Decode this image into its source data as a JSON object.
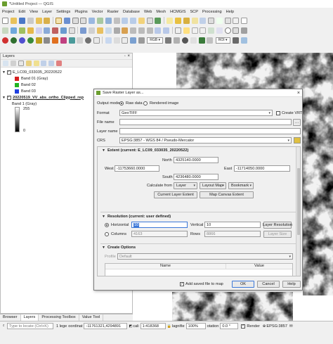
{
  "window": {
    "title": "*Untitled Project — QGIS"
  },
  "menu": [
    "Project",
    "Edit",
    "View",
    "Layer",
    "Settings",
    "Plugins",
    "Vector",
    "Raster",
    "Database",
    "Web",
    "Mesh",
    "HCMGIS",
    "SCP",
    "Processing",
    "Help"
  ],
  "toolbar": {
    "rgb_label": "RGB",
    "roi_label": "ROI"
  },
  "layers": {
    "title": "Layers",
    "items": [
      {
        "name": "E_LC09_033035_20220522",
        "bands": [
          {
            "label": "Band 01 (Gray)",
            "color": "#d62020"
          },
          {
            "label": "Band 02",
            "color": "#22b422"
          },
          {
            "label": "Band 03",
            "color": "#2040e0"
          }
        ]
      },
      {
        "name": "20220519_VV_abs_ortho_Clipped_rep",
        "band": "Band 1 (Gray)",
        "max": "255",
        "min": "0"
      }
    ]
  },
  "bottom_tabs": [
    "Browser",
    "Layers",
    "Processing Toolbox",
    "Value Tool"
  ],
  "dialog": {
    "title": "Save Raster Layer as...",
    "output_mode_label": "Output mode",
    "raw_data_label": "Raw data",
    "rendered_image_label": "Rendered image",
    "format_label": "Format",
    "format_value": "GeoTIFF",
    "create_vrt_label": "Create VRT",
    "file_name_label": "File name",
    "layer_name_label": "Layer name",
    "crs_label": "CRS",
    "crs_value": "EPSG:3857 - WGS 84 / Pseudo-Mercator",
    "extent": {
      "title": "Extent (current: E_LC09_033035_20220522)",
      "north_label": "North",
      "north": "4325140.0000",
      "west_label": "West",
      "west": "-11753660.0000",
      "east_label": "East",
      "east": "-11714050.0000",
      "south_label": "South",
      "south": "4236480.0000",
      "calculate_from_label": "Calculate from",
      "layer_btn": "Layer",
      "layout_map_btn": "Layout Map",
      "bookmark_btn": "Bookmark",
      "current_layer_extent_btn": "Current Layer Extent",
      "map_canvas_extent_btn": "Map Canvas Extent"
    },
    "resolution": {
      "title": "Resolution (current: user defined)",
      "horizontal_label": "Horizontal",
      "horizontal": "10",
      "vertical_label": "Vertical",
      "vertical": "10",
      "layer_resolution_btn": "Layer Resolution",
      "columns_label": "Columns",
      "columns": "4163",
      "rows_label": "Rows",
      "rows": "8866",
      "layer_size_btn": "Layer Size"
    },
    "create_options": {
      "title": "Create Options",
      "profile_label": "Profile",
      "profile_value": "Default",
      "col_name": "Name",
      "col_value": "Value"
    },
    "add_to_map_label": "Add saved file to map",
    "ok_label": "OK",
    "cancel_label": "Cancel",
    "help_label": "Help"
  },
  "status": {
    "search_placeholder": "Type to locate (Ctrl+K)",
    "message": "1 lege",
    "coordinate_label": "oordinat",
    "coordinate": "-11761321,4294891",
    "scale_label": "cali",
    "scale": "1:418368",
    "magnifier_label": "lagnifie",
    "magnifier": "100%",
    "rotation_label": "otation",
    "rotation": "0.0 °",
    "render_label": "Render",
    "crs": "EPSG:3857"
  }
}
